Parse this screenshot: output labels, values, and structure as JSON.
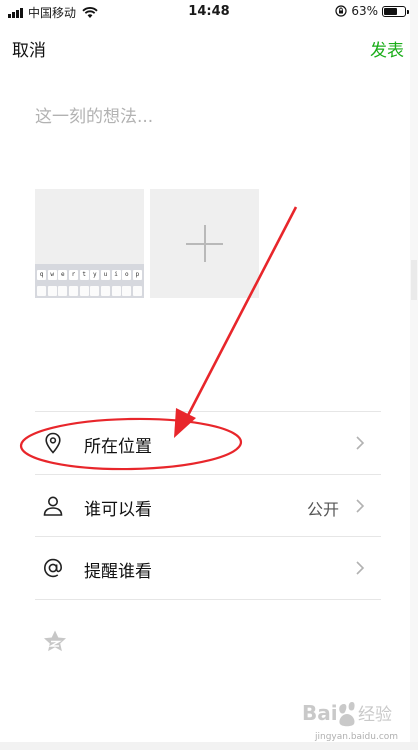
{
  "status_bar": {
    "carrier": "中国移动",
    "time": "14:48",
    "battery_percent": "63%",
    "battery_level": 0.63,
    "icons": [
      "signal-icon",
      "wifi-icon",
      "orientation-lock-icon",
      "battery-icon"
    ]
  },
  "nav": {
    "cancel_label": "取消",
    "publish_label": "发表",
    "publish_color": "#1aad19"
  },
  "composer": {
    "placeholder": "这一刻的想法..."
  },
  "photos": {
    "keyboard_keys": [
      "q",
      "w",
      "e",
      "r",
      "t",
      "y",
      "u",
      "i",
      "o",
      "p"
    ],
    "add_icon": "plus-icon"
  },
  "options": {
    "location": {
      "label": "所在位置",
      "icon": "location-pin-icon"
    },
    "visibility": {
      "label": "谁可以看",
      "value": "公开",
      "icon": "person-icon"
    },
    "mention": {
      "label": "提醒谁看",
      "icon": "at-icon"
    }
  },
  "footer": {
    "icon": "star-icon"
  },
  "annotation": {
    "color": "#e8262b"
  },
  "watermark": {
    "text": "jingyan.baidu.com",
    "logo": "Bai 经验"
  }
}
